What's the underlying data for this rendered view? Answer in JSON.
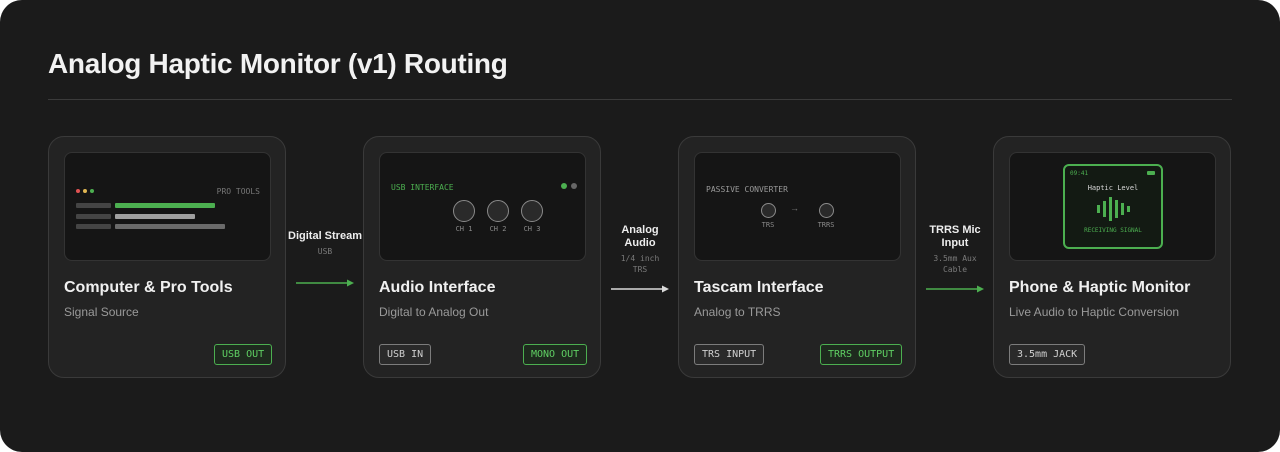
{
  "title": "Analog Haptic Monitor (v1) Routing",
  "accent_color": "#4caf50",
  "nodes": [
    {
      "title": "Computer & Pro Tools",
      "subtitle": "Signal Source",
      "preview": {
        "label": "PRO TOOLS",
        "window_dots": [
          "#e05252",
          "#e0b652",
          "#4caf50"
        ]
      },
      "tags": [
        {
          "text": "USB OUT",
          "style": "green"
        }
      ]
    },
    {
      "title": "Audio Interface",
      "subtitle": "Digital to Analog Out",
      "preview": {
        "label": "USB INTERFACE",
        "channels": [
          "CH 1",
          "CH 2",
          "CH 3"
        ]
      },
      "tags": [
        {
          "text": "USB IN",
          "style": "gray"
        },
        {
          "text": "MONO OUT",
          "style": "green"
        }
      ]
    },
    {
      "title": "Tascam Interface",
      "subtitle": "Analog to TRRS",
      "preview": {
        "label": "PASSIVE CONVERTER",
        "in_port": "TRS",
        "out_port": "TRRS"
      },
      "tags": [
        {
          "text": "TRS INPUT",
          "style": "gray"
        },
        {
          "text": "TRRS OUTPUT",
          "style": "green"
        }
      ]
    },
    {
      "title": "Phone & Haptic Monitor",
      "subtitle": "Live Audio to Haptic Conversion",
      "preview": {
        "time": "09:41",
        "heading": "Haptic Level",
        "status": "RECEIVING SIGNAL"
      },
      "tags": [
        {
          "text": "3.5mm JACK",
          "style": "gray"
        }
      ]
    }
  ],
  "connectors": [
    {
      "label": "Digital Stream",
      "sub": "USB",
      "color": "#4caf50"
    },
    {
      "label": "Analog Audio",
      "sub": "1/4 inch TRS",
      "color": "#d9d9d9"
    },
    {
      "label": "TRRS Mic Input",
      "sub": "3.5mm Aux Cable",
      "color": "#4caf50"
    }
  ]
}
